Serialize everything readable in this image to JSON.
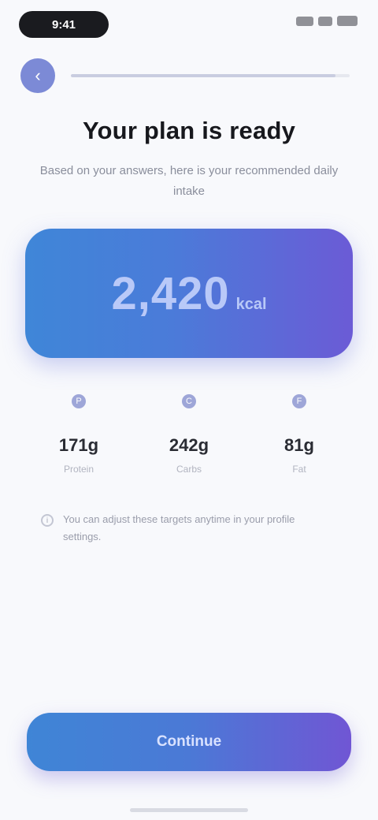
{
  "status_bar": {
    "time": "9:41"
  },
  "header": {
    "back_icon": "‹",
    "progress": 0.95
  },
  "title": "Your plan is ready",
  "subtitle": "Based on your answers, here is your recommended daily intake",
  "main_value": {
    "value": "2,420",
    "unit": "kcal"
  },
  "breakdown": [
    {
      "icon": "P",
      "value": "171g",
      "label": "Protein"
    },
    {
      "icon": "C",
      "value": "242g",
      "label": "Carbs"
    },
    {
      "icon": "F",
      "value": "81g",
      "label": "Fat"
    }
  ],
  "note": {
    "icon": "i",
    "text": "You can adjust these targets anytime in your profile settings."
  },
  "cta": {
    "label": "Continue"
  },
  "colors": {
    "gradient_start": "#3f86d8",
    "gradient_end": "#6b5bd6",
    "background": "#f8f9fc"
  }
}
